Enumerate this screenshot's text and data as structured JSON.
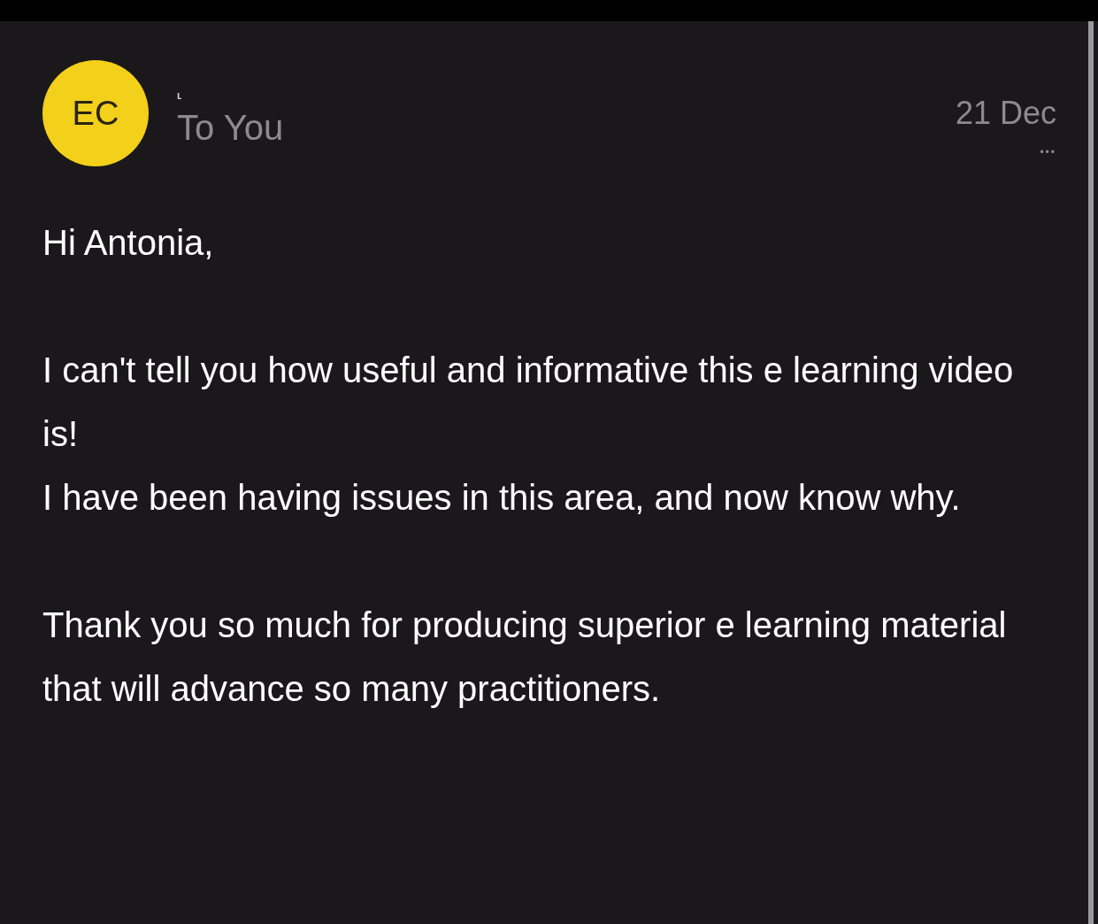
{
  "message": {
    "avatar": {
      "initials": "EC",
      "color": "#f3d01a"
    },
    "sender": "ʟ",
    "recipient": "To You",
    "date": "21 Dec",
    "more": "•••",
    "greeting": "Hi Antonia,",
    "paragraphs": [
      "I can't tell you how useful and informative this e learning video is!\nI have been having issues in this area, and now know why.",
      "Thank you so much for producing superior e learning material that will advance so many practitioners."
    ]
  }
}
